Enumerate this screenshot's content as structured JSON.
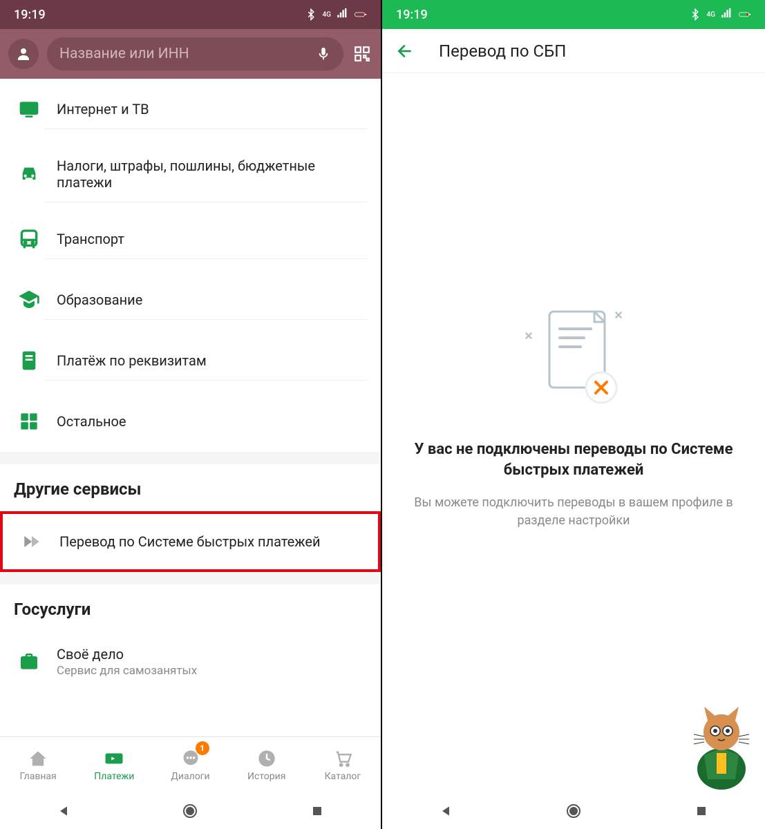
{
  "status": {
    "time": "19:19",
    "network": "4G"
  },
  "left": {
    "search_placeholder": "Название или ИНН",
    "categories": [
      {
        "icon": "tv",
        "label": "Интернет и ТВ"
      },
      {
        "icon": "car",
        "label": "Налоги, штрафы, пошлины, бюджетные платежи"
      },
      {
        "icon": "bus",
        "label": "Транспорт"
      },
      {
        "icon": "hat",
        "label": "Образование"
      },
      {
        "icon": "doc",
        "label": "Платёж по реквизитам"
      },
      {
        "icon": "grid",
        "label": "Остальное"
      }
    ],
    "sections": {
      "other_title": "Другие сервисы",
      "sbp_label": "Перевод по Системе быстрых платежей",
      "gos_title": "Госуслуги",
      "selfemp_title": "Своё дело",
      "selfemp_sub": "Сервис для самозанятых"
    },
    "nav": {
      "home": "Главная",
      "payments": "Платежи",
      "dialogs": "Диалоги",
      "history": "История",
      "catalog": "Каталог",
      "badge": "1"
    }
  },
  "right": {
    "title": "Перевод по СБП",
    "empty_title": "У вас не подключены переводы по Системе быстрых платежей",
    "empty_sub": "Вы можете подключить переводы в вашем профиле в разделе настройки"
  }
}
